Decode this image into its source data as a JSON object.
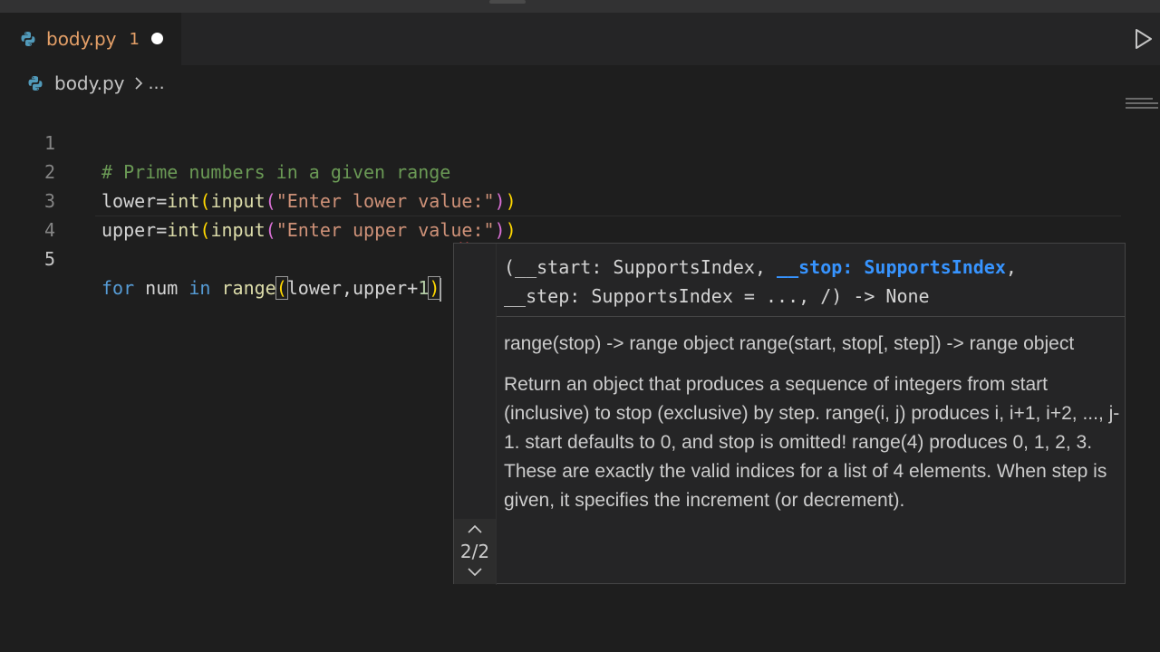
{
  "tab": {
    "filename": "body.py",
    "problem_count": "1"
  },
  "breadcrumb": {
    "file": "body.py",
    "ellipsis": "..."
  },
  "editor": {
    "line_numbers": [
      "1",
      "2",
      "3",
      "4",
      "5"
    ],
    "active_line": 5,
    "line1": {
      "comment": "# Prime numbers in a given range"
    },
    "line2": {
      "var": "lower",
      "op": "=",
      "fn1": "int",
      "lp1": "(",
      "fn2": "input",
      "lp2": "(",
      "str": "\"Enter lower value:\"",
      "rp2": ")",
      "rp1": ")"
    },
    "line3": {
      "var": "upper",
      "op": "=",
      "fn1": "int",
      "lp1": "(",
      "fn2": "input",
      "lp2": "(",
      "str": "\"Enter upper value:\"",
      "rp2": ")",
      "rp1": ")"
    },
    "line5": {
      "kw_for": "for",
      "var_num": "num",
      "kw_in": "in",
      "fn": "range",
      "lp": "(",
      "arg1": "lower",
      "comma": ",",
      "arg2": "upper",
      "plus": "+",
      "num": "1",
      "rp": ")"
    }
  },
  "signature_help": {
    "sig_part1": "(__start: SupportsIndex, ",
    "sig_active": "__stop: SupportsIndex",
    "sig_part2": ",",
    "sig_line2": "__step: SupportsIndex = ..., /) -> None",
    "doc_summary": "range(stop) -> range object range(start, stop[, step]) -> range object",
    "doc_body": "Return an object that produces a sequence of integers from start (inclusive) to stop (exclusive) by step. range(i, j) produces i, i+1, i+2, ..., j-1. start defaults to 0, and stop is omitted! range(4) produces 0, 1, 2, 3. These are exactly the valid indices for a list of 4 elements. When step is given, it specifies the increment (or decrement).",
    "overload_count": "2/2"
  },
  "colors": {
    "background": "#1e1e1e",
    "tab_modified": "#e5a068",
    "active_param": "#3794ff",
    "comment": "#6a9955",
    "keyword": "#569cd6",
    "function": "#dcdcaa",
    "string": "#ce9178",
    "number": "#b5cea8"
  },
  "icons": [
    "python-file-icon",
    "dirty-indicator-dot",
    "run-icon",
    "chevron-right-icon",
    "chevron-up-icon",
    "chevron-down-icon"
  ]
}
